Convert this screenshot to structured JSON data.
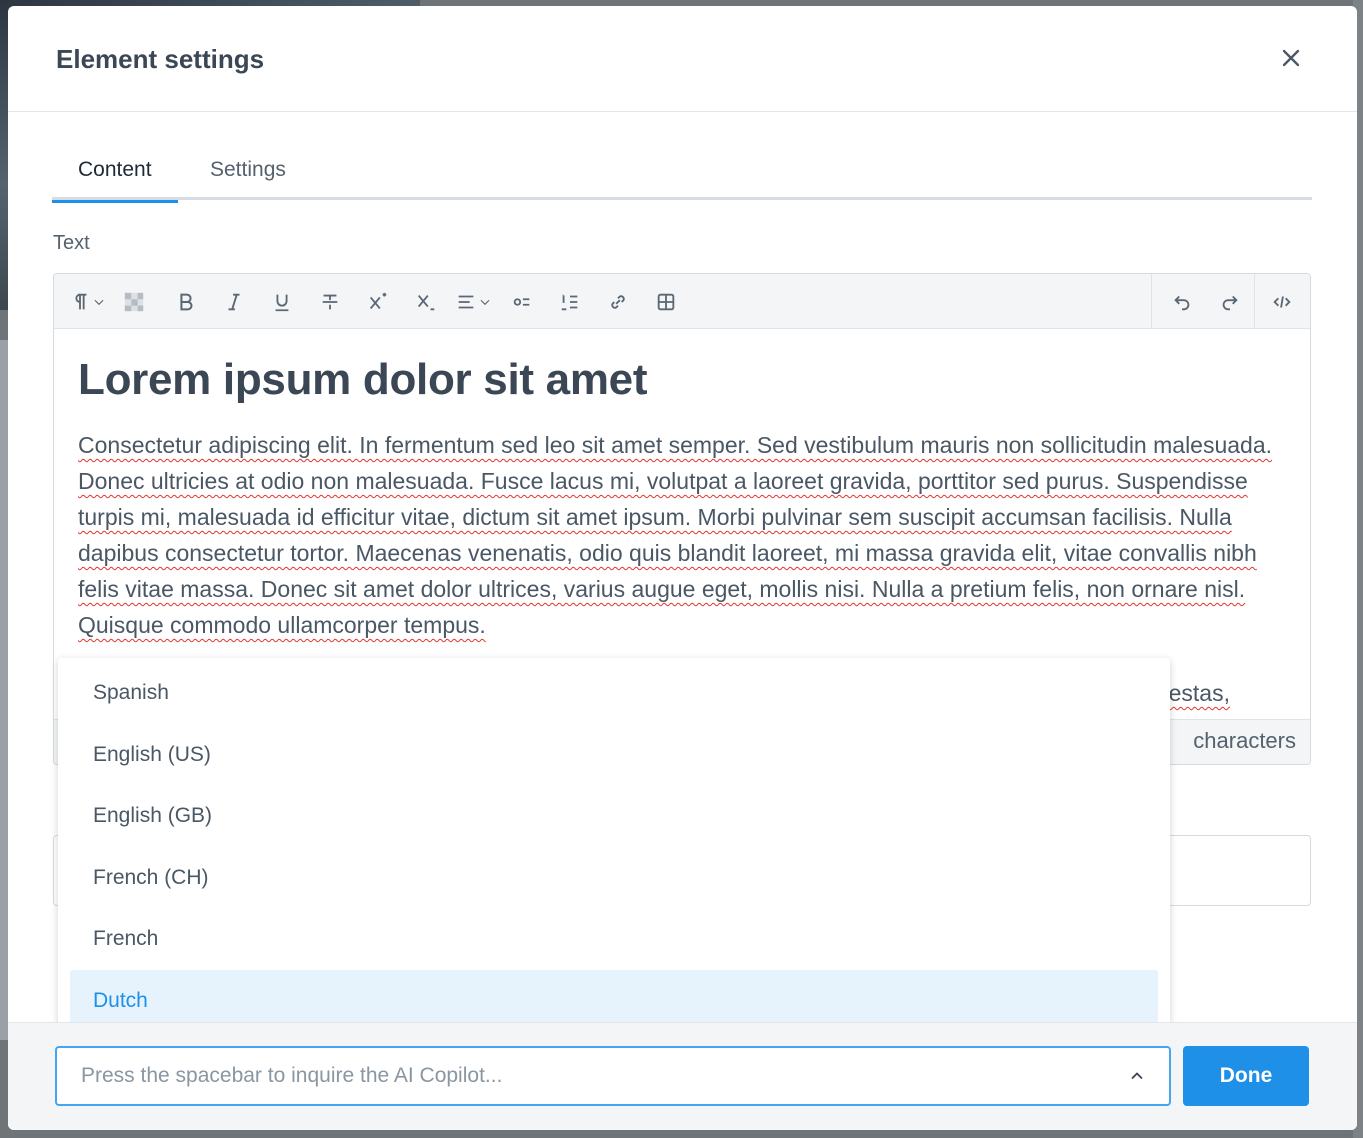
{
  "modal": {
    "title": "Element settings"
  },
  "tabs": [
    {
      "label": "Content",
      "active": true
    },
    {
      "label": "Settings",
      "active": false
    }
  ],
  "field": {
    "label": "Text"
  },
  "toolbar": {
    "icons": [
      "paragraph-icon",
      "chevron-down-icon",
      "checkerboard-icon",
      "bold-icon",
      "italic-icon",
      "underline-icon",
      "strikethrough-icon",
      "superscript-icon",
      "subscript-icon",
      "align-icon",
      "chevron-down-icon",
      "bullet-list-icon",
      "numbered-list-icon",
      "link-icon",
      "table-icon",
      "undo-icon",
      "redo-icon",
      "code-view-icon"
    ]
  },
  "editor": {
    "heading": "Lorem ipsum dolor sit amet",
    "paragraph": "Consectetur adipiscing elit. In fermentum sed leo sit amet semper. Sed vestibulum mauris non sollicitudin malesuada. Donec ultricies at odio non malesuada. Fusce lacus mi, volutpat a laoreet gravida, porttitor sed purus. Suspendisse turpis mi, malesuada id efficitur vitae, dictum sit amet ipsum. Morbi pulvinar sem suscipit accumsan facilisis. Nulla dapibus consectetur tortor. Maecenas venenatis, odio quis blandit laoreet, mi massa gravida elit, vitae convallis nibh felis vitae massa. Donec sit amet dolor ultrices, varius augue eget, mollis nisi. Nulla a pretium felis, non ornare nisl. Quisque commodo ullamcorper tempus.",
    "partial_line": "estas,",
    "char_count": "characters"
  },
  "dropdown": {
    "options": [
      "Spanish",
      "English (US)",
      "English (GB)",
      "French (CH)",
      "French",
      "Dutch"
    ],
    "selected": "Dutch"
  },
  "footer": {
    "copilot_placeholder": "Press the spacebar to inquire the AI Copilot...",
    "done_label": "Done"
  },
  "colors": {
    "accent": "#1e90e8",
    "selected_bg": "#e6f3fd",
    "title": "#3b4754"
  }
}
